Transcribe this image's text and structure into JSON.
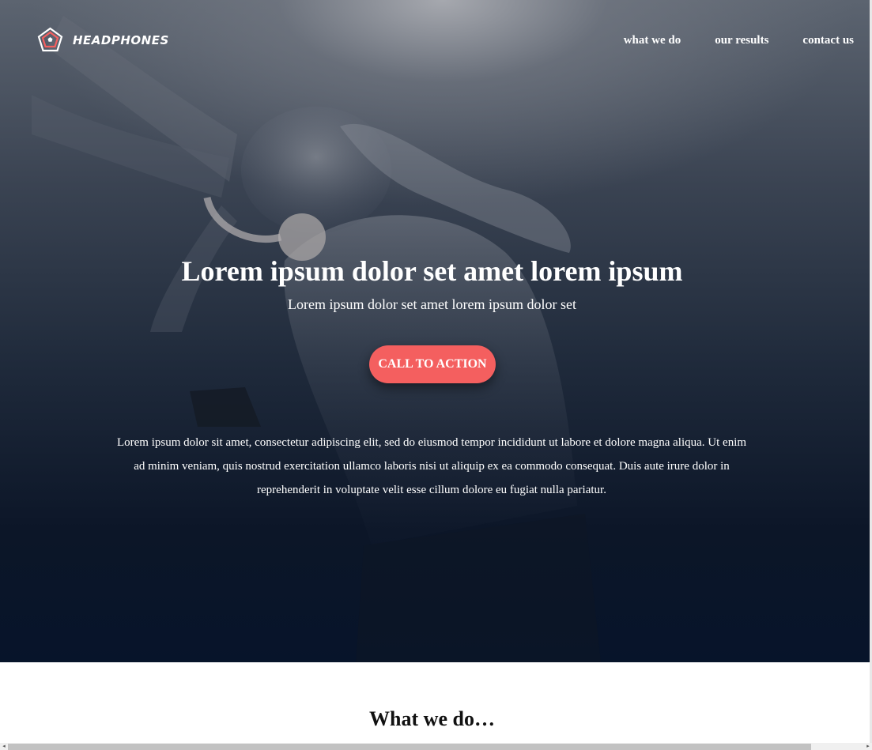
{
  "brand": {
    "name": "HEADPHONES",
    "colors": {
      "accent": "#f45f5f",
      "hero_dark": "#07142a",
      "text_light": "#ffffff"
    }
  },
  "nav": {
    "items": [
      {
        "label": "what we do"
      },
      {
        "label": "our results"
      },
      {
        "label": "contact us"
      }
    ]
  },
  "hero": {
    "title": "Lorem ipsum dolor set amet lorem ipsum",
    "subtitle": "Lorem ipsum dolor set amet lorem ipsum dolor set",
    "cta_label": "CALL TO ACTION",
    "body": "Lorem ipsum dolor sit amet, consectetur adipiscing elit, sed do eiusmod tempor incididunt ut labore et dolore magna aliqua. Ut enim ad minim veniam, quis nostrud exercitation ullamco laboris nisi ut aliquip ex ea commodo consequat. Duis aute irure dolor in reprehenderit in voluptate velit esse cillum dolore eu fugiat nulla pariatur."
  },
  "section": {
    "title": "What we do…"
  },
  "icons": {
    "logo": "pentagon-logo-icon",
    "scroll_left": "chevron-left-icon",
    "scroll_right": "chevron-right-icon"
  }
}
